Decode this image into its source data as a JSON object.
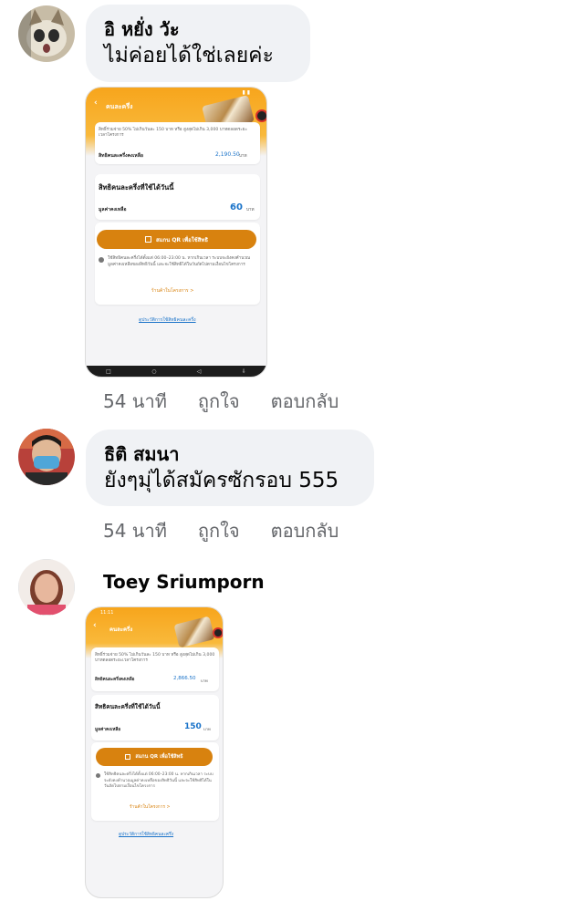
{
  "comments": [
    {
      "author": "อิ หยั่ง วัะ",
      "text": "ไม่ค่อยได้ใช่เลยค่ะ",
      "time": "54 นาที",
      "like": "ถูกใจ",
      "reply": "ตอบกลับ"
    },
    {
      "author": "ธิติ สมนา",
      "text": "ยังๆมุ่ได้สมัครซักรอบ 555",
      "time": "54 นาที",
      "like": "ถูกใจ",
      "reply": "ตอบกลับ"
    },
    {
      "author": "Toey Sriumporn"
    }
  ],
  "screens": [
    {
      "status_time": "",
      "title": "คนละครึ่ง",
      "desc": "สิทธิ์ร่วมจ่าย 50% ไม่เกินวันละ 150 บาท หรือ สูงสุดไม่เกิน 3,000 บาทตลอดระยะเวลาโครงการ",
      "remaining_label": "สิทธิคนละครึ่งคงเหลือ",
      "remaining_value": "2,190.50",
      "unit": "บาท",
      "today_title": "สิทธิคนละครึ่งที่ใช้ได้วันนี้",
      "balance_label": "มูลค่าคงเหลือ",
      "balance_value": "60",
      "scan_button": "สแกน QR เพื่อใช้สิทธิ",
      "info": "ใช้สิทธิคนละครึ่งได้ตั้งแต่ 06:00–23:00 น. หากเกินเวลา ระบบจะยังคงคำนวณมูลค่าคงเหลือของสิทธิวันนี้ และจะใช้สิทธิได้ในวันถัดไปตามเงื่อนไขโครงการ",
      "shops_link": "ร้านค้าในโครงการ >",
      "history_link": "ดูประวัติการใช้สิทธิคนละครึ่ง"
    },
    {
      "status_time": "11:11",
      "title": "คนละครึ่ง",
      "desc": "สิทธิ์ร่วมจ่าย 50% ไม่เกินวันละ 150 บาท หรือ สูงสุดไม่เกิน 3,000 บาทตลอดระยะเวลาโครงการ",
      "remaining_label": "สิทธิคนละครึ่งคงเหลือ",
      "remaining_value": "2,866.50",
      "unit": "บาท",
      "today_title": "สิทธิคนละครึ่งที่ใช้ได้วันนี้",
      "balance_label": "มูลค่าคงเหลือ",
      "balance_value": "150",
      "scan_button": "สแกน QR เพื่อใช้สิทธิ",
      "info": "ใช้สิทธิคนละครึ่งได้ตั้งแต่ 06:00–23:00 น. หากเกินเวลา ระบบจะยังคงคำนวณมูลค่าคงเหลือของสิทธิวันนี้ และจะใช้สิทธิได้ในวันถัดไปตามเงื่อนไขโครงการ",
      "shops_link": "ร้านค้าในโครงการ >",
      "history_link": "ดูประวัติการใช้สิทธิคนละครึ่ง"
    }
  ],
  "colors": {
    "bubble": "#f0f2f5",
    "meta": "#65676b",
    "accent_orange": "#f7a51c",
    "button_orange": "#d8820f",
    "value_blue": "#1a73c9"
  }
}
